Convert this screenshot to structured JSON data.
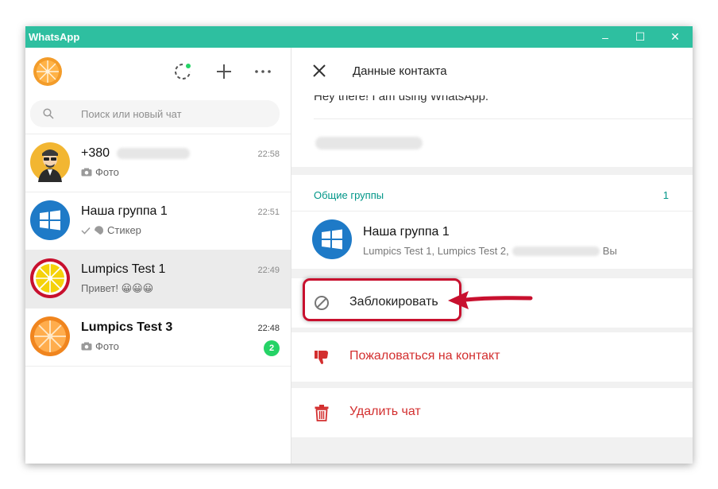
{
  "window": {
    "title": "WhatsApp",
    "controls": {
      "minimize": "–",
      "maximize": "☐",
      "close": "✕"
    }
  },
  "sidebar": {
    "header_icons": [
      "status-icon",
      "new-chat-icon",
      "menu-icon"
    ],
    "search": {
      "placeholder": "Поиск или новый чат",
      "value": ""
    },
    "chats": [
      {
        "name": "+380",
        "time": "22:58",
        "preview": "Фото",
        "preview_icon": "camera-icon",
        "unread": ""
      },
      {
        "name": "Наша группа 1",
        "time": "22:51",
        "preview": "Стикер",
        "preview_icon": "sticker-icon",
        "unread": ""
      },
      {
        "name": "Lumpics Test 1",
        "time": "22:49",
        "preview": "Привет! 😀😀😀",
        "preview_icon": "",
        "unread": ""
      },
      {
        "name": "Lumpics Test 3",
        "time": "22:48",
        "preview": "Фото",
        "preview_icon": "camera-icon",
        "unread": "2"
      }
    ]
  },
  "contact_panel": {
    "title": "Данные контакта",
    "about": "Hey there! I am using WhatsApp.",
    "groups_header": "Общие группы",
    "groups_count": "1",
    "group": {
      "name": "Наша группа 1",
      "members": "Lumpics Test 1, Lumpics Test 2,",
      "members_suffix": "Вы"
    },
    "actions": {
      "block": "Заблокировать",
      "report": "Пожаловаться на контакт",
      "delete": "Удалить чат"
    }
  },
  "colors": {
    "titlebar": "#2ebfa0",
    "accent": "#009688",
    "danger": "#d32f2f",
    "highlight": "#c8102e",
    "unread_badge": "#25d366"
  }
}
